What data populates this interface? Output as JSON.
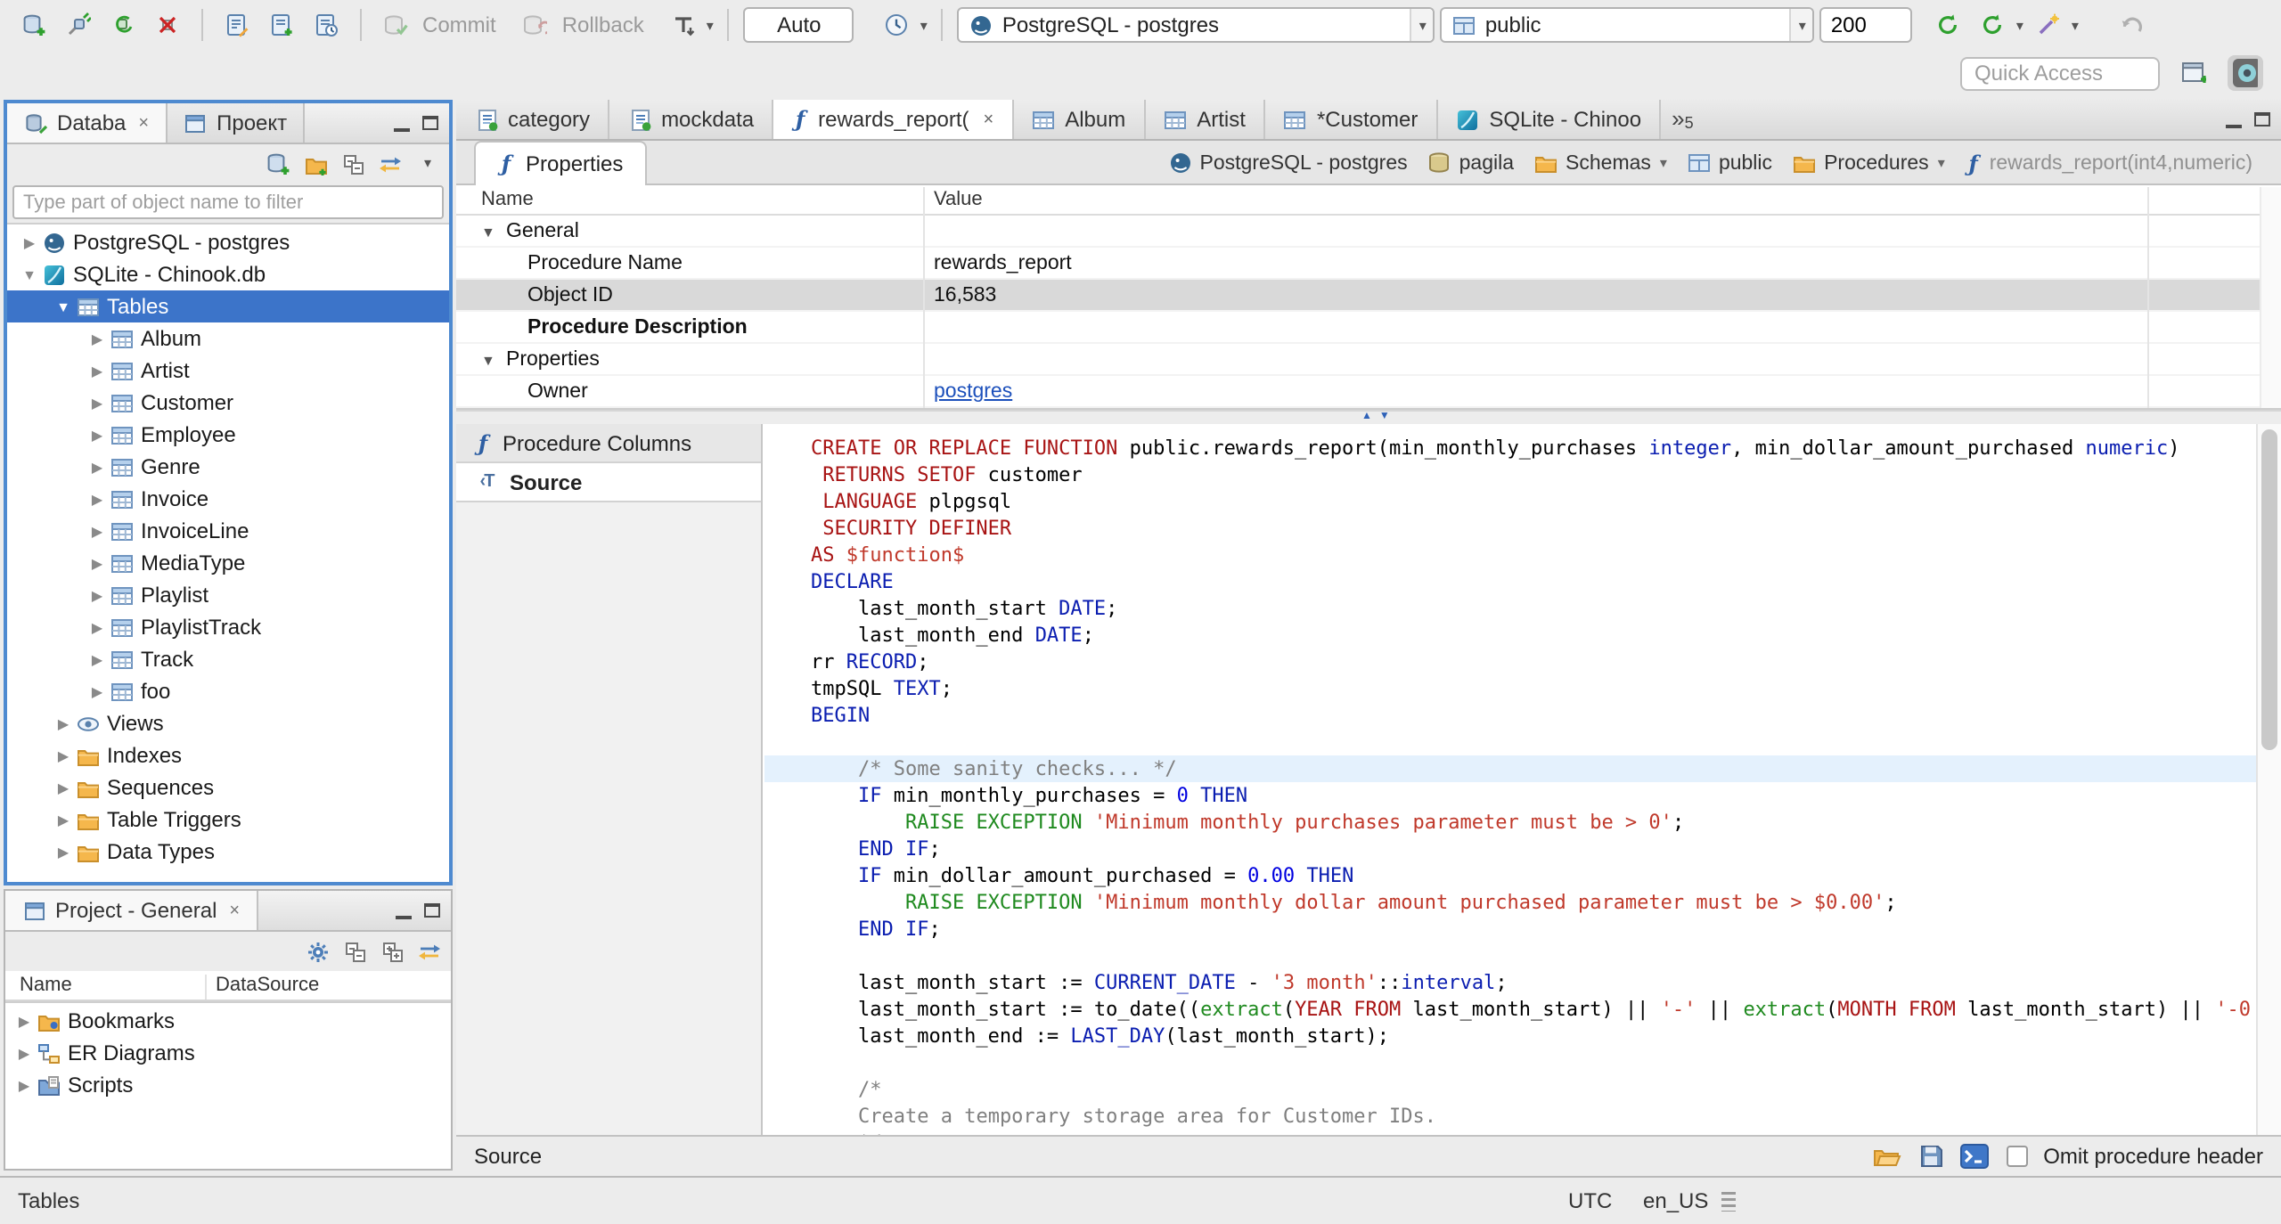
{
  "icons": {
    "collapsed": "▶",
    "expanded": "▼",
    "caret": "▾",
    "close": "×",
    "overflow_chevron": "»",
    "splitter_up": "▲",
    "splitter_down": "▼"
  },
  "toolbar": {
    "commit": "Commit",
    "rollback": "Rollback",
    "auto": "Auto",
    "connection": "PostgreSQL - postgres",
    "schema": "public",
    "fetch_size": "200",
    "quick_access_placeholder": "Quick Access"
  },
  "navigator": {
    "tab_database": "Databa",
    "tab_project": "Проект",
    "filter_placeholder": "Type part of object name to filter",
    "tree": [
      {
        "indent": 0,
        "arrow": "c",
        "icon": "postgres",
        "label": "PostgreSQL - postgres"
      },
      {
        "indent": 0,
        "arrow": "e",
        "icon": "sqlite",
        "label": "SQLite - Chinook.db"
      },
      {
        "indent": 1,
        "arrow": "e",
        "icon": "table",
        "label": "Tables",
        "selected": true
      },
      {
        "indent": 2,
        "arrow": "c",
        "icon": "table",
        "label": "Album"
      },
      {
        "indent": 2,
        "arrow": "c",
        "icon": "table",
        "label": "Artist"
      },
      {
        "indent": 2,
        "arrow": "c",
        "icon": "table",
        "label": "Customer"
      },
      {
        "indent": 2,
        "arrow": "c",
        "icon": "table",
        "label": "Employee"
      },
      {
        "indent": 2,
        "arrow": "c",
        "icon": "table",
        "label": "Genre"
      },
      {
        "indent": 2,
        "arrow": "c",
        "icon": "table",
        "label": "Invoice"
      },
      {
        "indent": 2,
        "arrow": "c",
        "icon": "table",
        "label": "InvoiceLine"
      },
      {
        "indent": 2,
        "arrow": "c",
        "icon": "table",
        "label": "MediaType"
      },
      {
        "indent": 2,
        "arrow": "c",
        "icon": "table",
        "label": "Playlist"
      },
      {
        "indent": 2,
        "arrow": "c",
        "icon": "table",
        "label": "PlaylistTrack"
      },
      {
        "indent": 2,
        "arrow": "c",
        "icon": "table",
        "label": "Track"
      },
      {
        "indent": 2,
        "arrow": "c",
        "icon": "table",
        "label": "foo"
      },
      {
        "indent": 1,
        "arrow": "c",
        "icon": "views",
        "label": "Views"
      },
      {
        "indent": 1,
        "arrow": "c",
        "icon": "folder",
        "label": "Indexes"
      },
      {
        "indent": 1,
        "arrow": "c",
        "icon": "folder",
        "label": "Sequences"
      },
      {
        "indent": 1,
        "arrow": "c",
        "icon": "folder",
        "label": "Table Triggers"
      },
      {
        "indent": 1,
        "arrow": "c",
        "icon": "folder",
        "label": "Data Types"
      }
    ]
  },
  "project_panel": {
    "title": "Project - General",
    "columns": [
      "Name",
      "DataSource"
    ],
    "tree": [
      {
        "icon": "bookmarks",
        "label": "Bookmarks"
      },
      {
        "icon": "erd",
        "label": "ER Diagrams"
      },
      {
        "icon": "scripts",
        "label": "Scripts"
      }
    ]
  },
  "editor": {
    "tabs": [
      {
        "icon": "sqlfile",
        "label": "category"
      },
      {
        "icon": "sqlfile",
        "label": "mockdata"
      },
      {
        "icon": "func",
        "label": "rewards_report(",
        "active": true,
        "closable": true
      },
      {
        "icon": "table",
        "label": "Album"
      },
      {
        "icon": "table",
        "label": "Artist"
      },
      {
        "icon": "table",
        "label": "*Customer"
      },
      {
        "icon": "sqlite",
        "label": "SQLite - Chinoo"
      }
    ],
    "overflow_count": "5",
    "properties_tab": "Properties",
    "breadcrumb": [
      {
        "icon": "postgres",
        "label": "PostgreSQL - postgres"
      },
      {
        "icon": "database",
        "label": "pagila"
      },
      {
        "icon": "folder",
        "label": "Schemas",
        "caret": true
      },
      {
        "icon": "schema",
        "label": "public"
      },
      {
        "icon": "folder",
        "label": "Procedures",
        "caret": true
      },
      {
        "icon": "func",
        "label": "rewards_report(int4,numeric)",
        "dim": true
      }
    ],
    "grid": {
      "columns": [
        "Name",
        "Value"
      ],
      "rows": [
        {
          "type": "group",
          "name": "General"
        },
        {
          "name": "Procedure Name",
          "value": "rewards_report"
        },
        {
          "name": "Object ID",
          "value": "16,583",
          "selected": true
        },
        {
          "name": "Procedure Description",
          "bold": true,
          "value": ""
        },
        {
          "type": "group",
          "name": "Properties"
        },
        {
          "name": "Owner",
          "value": "postgres",
          "link": true
        }
      ]
    },
    "subtabs": [
      {
        "icon": "func",
        "label": "Procedure Columns"
      },
      {
        "icon": "source",
        "label": "Source",
        "active": true
      }
    ],
    "bottom_label": "Source",
    "omit_checkbox": "Omit procedure header"
  },
  "code": {
    "lines": [
      {
        "s": [
          [
            "k",
            "CREATE OR REPLACE FUNCTION"
          ],
          [
            "p",
            " public.rewards_report(min_monthly_purchases "
          ],
          [
            "t",
            "integer"
          ],
          [
            "p",
            ", min_dollar_amount_purchased "
          ],
          [
            "t",
            "numeric"
          ],
          [
            "p",
            ")"
          ]
        ]
      },
      {
        "s": [
          [
            "p",
            " "
          ],
          [
            "k",
            "RETURNS SETOF"
          ],
          [
            "p",
            " customer"
          ]
        ]
      },
      {
        "s": [
          [
            "p",
            " "
          ],
          [
            "k",
            "LANGUAGE"
          ],
          [
            "p",
            " plpgsql"
          ]
        ]
      },
      {
        "s": [
          [
            "p",
            " "
          ],
          [
            "k",
            "SECURITY DEFINER"
          ]
        ]
      },
      {
        "s": [
          [
            "k",
            "AS"
          ],
          [
            "p",
            " "
          ],
          [
            "s",
            "$function$"
          ]
        ]
      },
      {
        "s": [
          [
            "t",
            "DECLARE"
          ]
        ]
      },
      {
        "s": [
          [
            "p",
            "    last_month_start "
          ],
          [
            "t",
            "DATE"
          ],
          [
            "p",
            ";"
          ]
        ]
      },
      {
        "s": [
          [
            "p",
            "    last_month_end "
          ],
          [
            "t",
            "DATE"
          ],
          [
            "p",
            ";"
          ]
        ]
      },
      {
        "s": [
          [
            "p",
            "rr "
          ],
          [
            "t",
            "RECORD"
          ],
          [
            "p",
            ";"
          ]
        ]
      },
      {
        "s": [
          [
            "p",
            "tmpSQL "
          ],
          [
            "t",
            "TEXT"
          ],
          [
            "p",
            ";"
          ]
        ]
      },
      {
        "s": [
          [
            "t",
            "BEGIN"
          ]
        ]
      },
      {
        "s": []
      },
      {
        "hl": true,
        "s": [
          [
            "p",
            "    "
          ],
          [
            "c",
            "/* Some sanity checks... */"
          ]
        ]
      },
      {
        "s": [
          [
            "p",
            "    "
          ],
          [
            "t",
            "IF"
          ],
          [
            "p",
            " min_monthly_purchases = "
          ],
          [
            "n",
            "0"
          ],
          [
            "p",
            " "
          ],
          [
            "t",
            "THEN"
          ]
        ]
      },
      {
        "s": [
          [
            "p",
            "        "
          ],
          [
            "f",
            "RAISE EXCEPTION"
          ],
          [
            "p",
            " "
          ],
          [
            "s",
            "'Minimum monthly purchases parameter must be > 0'"
          ],
          [
            "p",
            ";"
          ]
        ]
      },
      {
        "s": [
          [
            "p",
            "    "
          ],
          [
            "t",
            "END IF"
          ],
          [
            "p",
            ";"
          ]
        ]
      },
      {
        "s": [
          [
            "p",
            "    "
          ],
          [
            "t",
            "IF"
          ],
          [
            "p",
            " min_dollar_amount_purchased = "
          ],
          [
            "n",
            "0.00"
          ],
          [
            "p",
            " "
          ],
          [
            "t",
            "THEN"
          ]
        ]
      },
      {
        "s": [
          [
            "p",
            "        "
          ],
          [
            "f",
            "RAISE EXCEPTION"
          ],
          [
            "p",
            " "
          ],
          [
            "s",
            "'Minimum monthly dollar amount purchased parameter must be > $0.00'"
          ],
          [
            "p",
            ";"
          ]
        ]
      },
      {
        "s": [
          [
            "p",
            "    "
          ],
          [
            "t",
            "END IF"
          ],
          [
            "p",
            ";"
          ]
        ]
      },
      {
        "s": []
      },
      {
        "s": [
          [
            "p",
            "    last_month_start := "
          ],
          [
            "t",
            "CURRENT_DATE"
          ],
          [
            "p",
            " - "
          ],
          [
            "s",
            "'3 month'"
          ],
          [
            "p",
            "::"
          ],
          [
            "t",
            "interval"
          ],
          [
            "p",
            ";"
          ]
        ]
      },
      {
        "s": [
          [
            "p",
            "    last_month_start := to_date(("
          ],
          [
            "f",
            "extract"
          ],
          [
            "p",
            "("
          ],
          [
            "k",
            "YEAR FROM"
          ],
          [
            "p",
            " last_month_start) || "
          ],
          [
            "s",
            "'-'"
          ],
          [
            "p",
            " || "
          ],
          [
            "f",
            "extract"
          ],
          [
            "p",
            "("
          ],
          [
            "k",
            "MONTH FROM"
          ],
          [
            "p",
            " last_month_start) || "
          ],
          [
            "s",
            "'-0"
          ]
        ]
      },
      {
        "s": [
          [
            "p",
            "    last_month_end := "
          ],
          [
            "t",
            "LAST_DAY"
          ],
          [
            "p",
            "(last_month_start);"
          ]
        ]
      },
      {
        "s": []
      },
      {
        "s": [
          [
            "p",
            "    "
          ],
          [
            "c",
            "/*"
          ]
        ]
      },
      {
        "s": [
          [
            "p",
            "    "
          ],
          [
            "c",
            "Create a temporary storage area for Customer IDs."
          ]
        ]
      },
      {
        "s": [
          [
            "p",
            "    "
          ],
          [
            "c",
            "*/"
          ]
        ]
      }
    ]
  },
  "statusbar": {
    "left": "Tables",
    "timezone": "UTC",
    "locale": "en_US"
  }
}
